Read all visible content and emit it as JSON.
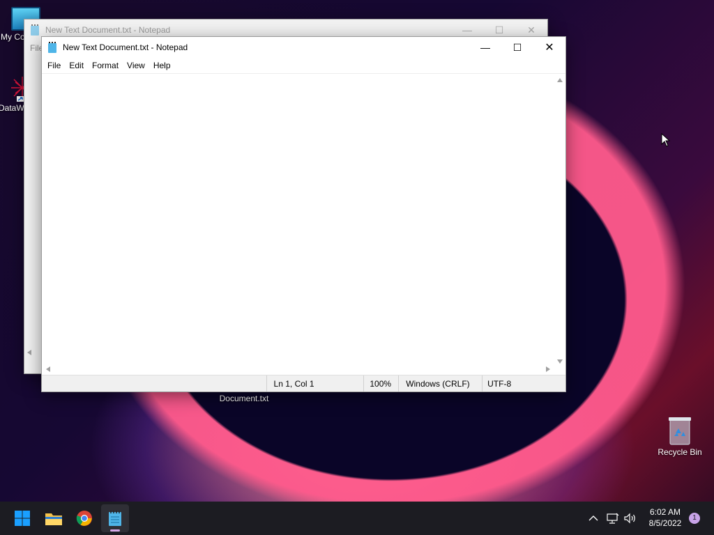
{
  "desktop": {
    "icons": [
      {
        "label": "My Co"
      },
      {
        "label": "DataW"
      },
      {
        "label": "Recycle Bin"
      }
    ],
    "file_label": "Document.txt"
  },
  "back_window": {
    "title": "New Text Document.txt - Notepad",
    "menu_partial": "File"
  },
  "notepad": {
    "title": "New Text Document.txt - Notepad",
    "controls": {
      "minimize": "—",
      "maximize": "☐",
      "close": "✕"
    },
    "menu": [
      "File",
      "Edit",
      "Format",
      "View",
      "Help"
    ],
    "content": "",
    "status": {
      "position": "Ln 1, Col 1",
      "zoom": "100%",
      "line_ending": "Windows (CRLF)",
      "encoding": "UTF-8"
    }
  },
  "taskbar": {
    "time": "6:02 AM",
    "date": "8/5/2022",
    "notification_count": "1"
  },
  "colors": {
    "taskbar_bg": "#1c1c22",
    "notepad_icon": "#4fb5e8",
    "start_blue": "#1a9fff",
    "notification": "#c8a3e8"
  }
}
